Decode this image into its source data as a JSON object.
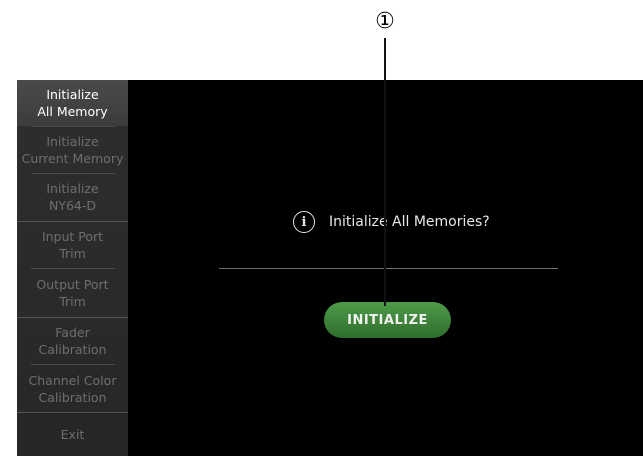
{
  "callout": {
    "marker": "①"
  },
  "sidebar": {
    "items": [
      {
        "label": "Initialize\nAll Memory",
        "active": true
      },
      {
        "label": "Initialize\nCurrent Memory",
        "active": false
      },
      {
        "label": "Initialize\nNY64-D",
        "active": false
      },
      {
        "label": "Input Port\nTrim",
        "active": false
      },
      {
        "label": "Output Port\nTrim",
        "active": false
      },
      {
        "label": "Fader\nCalibration",
        "active": false
      },
      {
        "label": "Channel Color\nCalibration",
        "active": false
      },
      {
        "label": "Exit",
        "active": false
      }
    ]
  },
  "main": {
    "message": "Initialize All Memories?",
    "button_label": "INITIALIZE"
  },
  "colors": {
    "button_green": "#3f8a3b",
    "screen_bg": "#000000",
    "sidebar_bg": "#2b2b2b"
  },
  "icons": {
    "info": "info-icon"
  }
}
